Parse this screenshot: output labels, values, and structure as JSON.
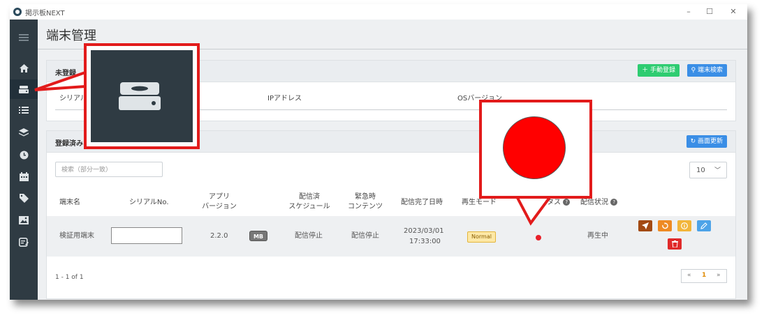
{
  "window": {
    "title": "掲示板NEXT",
    "minimize": "–",
    "maximize": "☐",
    "close": "✕"
  },
  "page": {
    "title": "端末管理"
  },
  "sidebar": {
    "items": [
      {
        "name": "menu-icon"
      },
      {
        "name": "home-icon"
      },
      {
        "name": "terminal-icon"
      },
      {
        "name": "list-icon"
      },
      {
        "name": "layers-icon"
      },
      {
        "name": "clock-icon"
      },
      {
        "name": "calendar-icon"
      },
      {
        "name": "tag-icon"
      },
      {
        "name": "image-icon"
      },
      {
        "name": "edit-note-icon"
      }
    ]
  },
  "unregistered": {
    "title": "未登録",
    "add_button": "手動登録",
    "search_button": "端末検索",
    "columns": [
      "シリアル",
      "IPアドレス",
      "OSバージョン"
    ]
  },
  "registered": {
    "title": "登録済み",
    "refresh_button": "画面更新",
    "search_placeholder": "検索（部分一致）",
    "page_size": "10",
    "columns": {
      "name": "端末名",
      "serial": "シリアルNo.",
      "app_version": "アプリ\nバージョン",
      "schedule": "配信済\nスケジュール",
      "emergency": "緊急時\nコンテンツ",
      "delivered_at": "配信完了日時",
      "play_mode": "再生モード",
      "status": "ステータス",
      "delivery_status": "配信状況"
    },
    "rows": [
      {
        "name": "検証用端末",
        "serial": "",
        "app_version": "2.2.0",
        "badge": "MB",
        "schedule": "配信停止",
        "emergency": "配信停止",
        "delivered_date": "2023/03/01",
        "delivered_time": "17:33:00",
        "play_mode": "Normal",
        "delivery_status": "再生中"
      }
    ],
    "range": "1 - 1 of 1",
    "pager": {
      "prev": "«",
      "current": "1",
      "next": "»"
    }
  },
  "colors": {
    "sidebar": "#2f3b43",
    "green": "#2ecc71",
    "blue": "#3a8ee6",
    "status_red": "#e8202a",
    "callout": "#e21b1b"
  }
}
